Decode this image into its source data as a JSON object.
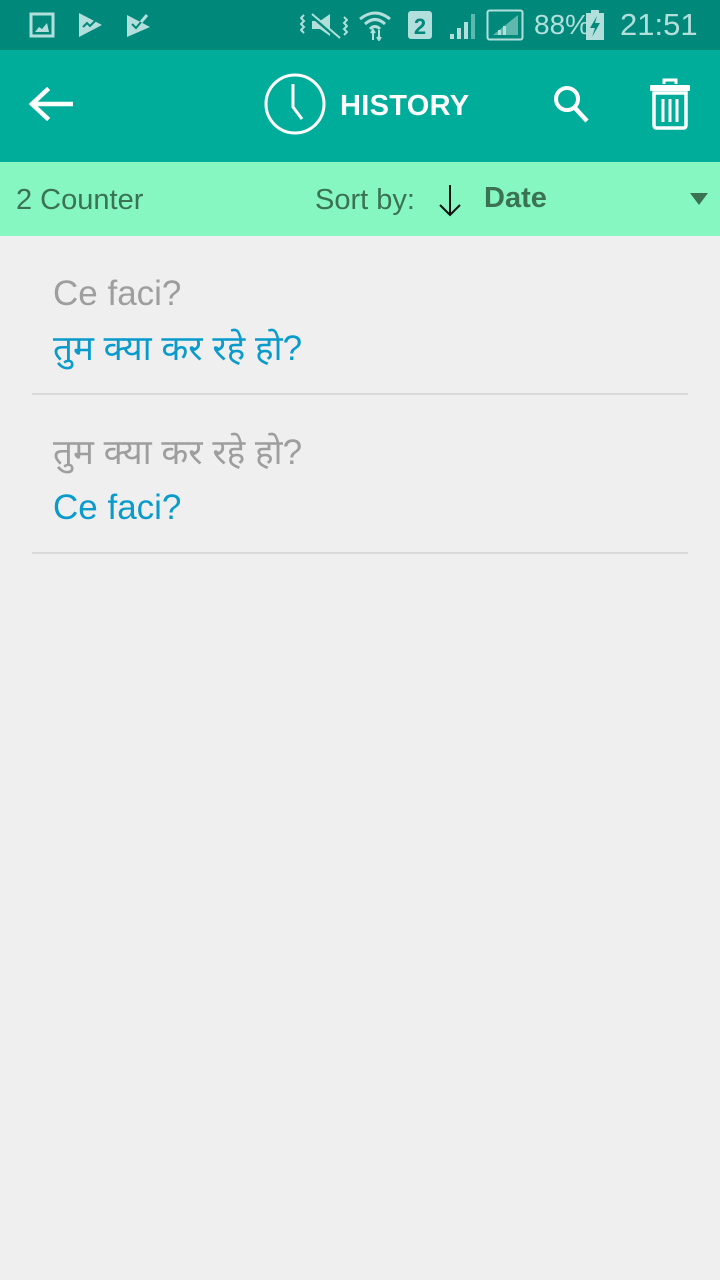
{
  "status_bar": {
    "left_icons": [
      "gallery-icon",
      "play-store-icon",
      "task-check-icon"
    ],
    "right_icons": [
      "vibrate-mute-icon",
      "wifi-icon",
      "sim-2-icon",
      "signal-icon",
      "signal-sim-icon",
      "battery-charging-icon"
    ],
    "sim_label": "2",
    "battery": "88%",
    "time": "21:51"
  },
  "app_bar": {
    "title": "HISTORY",
    "back_icon": "arrow-back-icon",
    "title_icon": "clock-icon",
    "search_icon": "search-icon",
    "delete_icon": "trash-icon"
  },
  "sort_bar": {
    "counter": "2 Counter",
    "sort_label": "Sort by:",
    "sort_direction": "descending",
    "sort_value": "Date"
  },
  "history": [
    {
      "source": "Ce faci?",
      "translation": "तुम क्या कर रहे हो?"
    },
    {
      "source": "तुम क्या कर रहे हो?",
      "translation": "Ce faci?"
    }
  ],
  "colors": {
    "status_bar": "#00897b",
    "app_bar": "#00ac9a",
    "sort_bar": "#86f7c0",
    "source_text": "#9e9e9e",
    "translation_text": "#0a9bcc",
    "background": "#efefef"
  }
}
